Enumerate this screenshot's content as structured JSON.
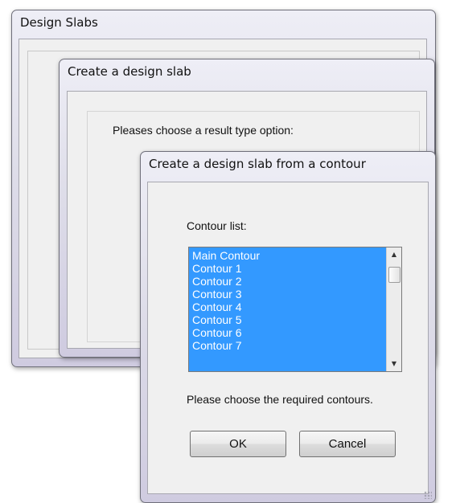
{
  "windows": {
    "design_slabs": {
      "title": "Design Slabs"
    },
    "create_design_slab": {
      "title": "Create a design slab",
      "prompt": "Pleases choose a result type option:"
    },
    "from_contour": {
      "title": "Create a design slab from a contour",
      "contour_list_label": "Contour list:",
      "contours": [
        "Main Contour",
        "Contour 1",
        "Contour 2",
        "Contour 3",
        "Contour 4",
        "Contour 5",
        "Contour 6",
        "Contour 7"
      ],
      "hint": "Please choose the required contours.",
      "ok_label": "OK",
      "cancel_label": "Cancel"
    }
  },
  "colors": {
    "selection": "#3399ff"
  }
}
